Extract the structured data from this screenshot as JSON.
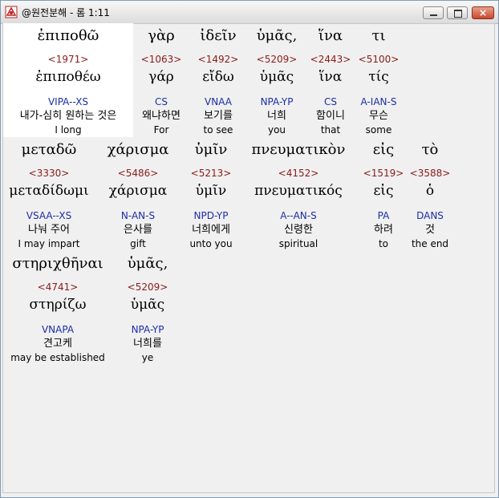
{
  "window": {
    "title": "@원전분해 - 롬 1:11"
  },
  "controls": {
    "close_glyph": "×"
  },
  "words": [
    {
      "greek": "ἐπιποθῶ",
      "strong": "<1971>",
      "lemma": "ἐπιποθέω",
      "parse": "VIPA--XS",
      "korean": "내가-심히 원하는 것은",
      "english": "I long"
    },
    {
      "greek": "γὰρ",
      "strong": "<1063>",
      "lemma": "γάρ",
      "parse": "CS",
      "korean": "왜냐하면",
      "english": "For"
    },
    {
      "greek": "ἰδεῖν",
      "strong": "<1492>",
      "lemma": "εἴδω",
      "parse": "VNAA",
      "korean": "보기를",
      "english": "to see"
    },
    {
      "greek": "ὑμᾶς,",
      "strong": "<5209>",
      "lemma": "ὑμᾶς",
      "parse": "NPA-YP",
      "korean": "너희",
      "english": "you"
    },
    {
      "greek": "ἵνα",
      "strong": "<2443>",
      "lemma": "ἵνα",
      "parse": "CS",
      "korean": "함이니",
      "english": "that"
    },
    {
      "greek": "τι",
      "strong": "<5100>",
      "lemma": "τίς",
      "parse": "A-IAN-S",
      "korean": "무슨",
      "english": "some"
    },
    {
      "greek": "μεταδῶ",
      "strong": "<3330>",
      "lemma": "μεταδίδωμι",
      "parse": "VSAA--XS",
      "korean": "나눠 주어",
      "english": "I may impart"
    },
    {
      "greek": "χάρισμα",
      "strong": "<5486>",
      "lemma": "χάρισμα",
      "parse": "N-AN-S",
      "korean": "은사를",
      "english": "gift"
    },
    {
      "greek": "ὑμῖν",
      "strong": "<5213>",
      "lemma": "ὑμῖν",
      "parse": "NPD-YP",
      "korean": "너희에게",
      "english": "unto you"
    },
    {
      "greek": "πνευματικὸν",
      "strong": "<4152>",
      "lemma": "πνευματικός",
      "parse": "A--AN-S",
      "korean": "신령한",
      "english": "spiritual"
    },
    {
      "greek": "εἰς",
      "strong": "<1519>",
      "lemma": "εἰς",
      "parse": "PA",
      "korean": "하려",
      "english": "to"
    },
    {
      "greek": "τὸ",
      "strong": "<3588>",
      "lemma": "ὁ",
      "parse": "DANS",
      "korean": "것",
      "english": "the end"
    },
    {
      "greek": "στηριχθῆναι",
      "strong": "<4741>",
      "lemma": "στηρίζω",
      "parse": "VNAPA",
      "korean": "견고케",
      "english": "may be established"
    },
    {
      "greek": "ὑμᾶς,",
      "strong": "<5209>",
      "lemma": "ὑμᾶς",
      "parse": "NPA-YP",
      "korean": "너희를",
      "english": "ye"
    }
  ],
  "colors": {
    "strong": "#8b1a1a",
    "parse": "#1c2ea6",
    "highlight": "#ffffff"
  }
}
